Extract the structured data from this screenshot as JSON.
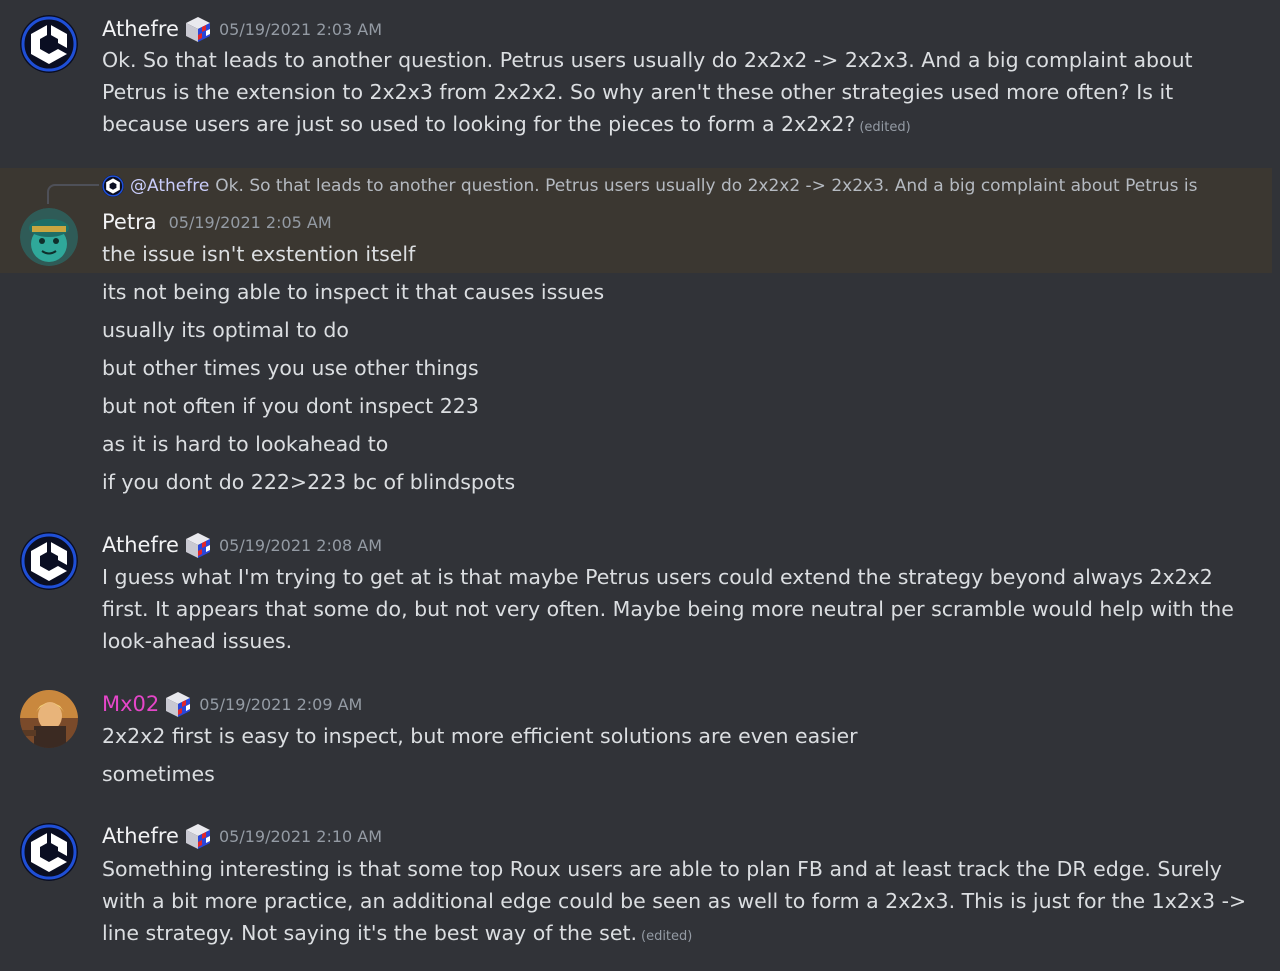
{
  "messages": [
    {
      "author": "Athefre",
      "timestamp": "05/19/2021 2:03 AM",
      "lines": [
        "Ok. So that leads to another question. Petrus users usually do 2x2x2 -> 2x2x3. And a big complaint about",
        "Petrus is the extension to 2x2x3 from 2x2x2. So why aren't these other strategies used more often? Is it",
        "because users are just so used to looking for the pieces to form a 2x2x2?"
      ],
      "edited": "(edited)"
    },
    {
      "reply": {
        "mention": "@Athefre",
        "text": "Ok. So that leads to another question. Petrus users usually do 2x2x2 -> 2x2x3. And a big complaint about Petrus is"
      },
      "author": "Petra",
      "timestamp": "05/19/2021 2:05 AM",
      "lines": [
        "the issue isn't exstention itself",
        "its not being able to inspect it that causes issues",
        "usually its optimal to do",
        "but other times you use other things",
        "but not often if you dont inspect 223",
        "as it is hard to lookahead to",
        "if you dont do 222>223 bc of blindspots"
      ]
    },
    {
      "author": "Athefre",
      "timestamp": "05/19/2021 2:08 AM",
      "lines": [
        "I guess what I'm trying to get at is that maybe Petrus users could extend the strategy beyond always 2x2x2",
        "first. It appears that some do, but not very often. Maybe being more neutral per scramble would help with the",
        "look-ahead issues."
      ]
    },
    {
      "author": "Mx02",
      "timestamp": "05/19/2021 2:09 AM",
      "lines": [
        "2x2x2 first is easy to inspect, but more efficient solutions are even easier",
        "sometimes"
      ]
    },
    {
      "author": "Athefre",
      "timestamp": "05/19/2021 2:10 AM",
      "lines": [
        "Something interesting is that some top Roux users are able to plan FB and at least track the DR edge. Surely",
        "with a bit more practice, an additional edge could be seen as well to form a 2x2x3. This is just for the 1x2x3 ->",
        "line strategy. Not saying it's the best way of the set."
      ],
      "edited": "(edited)"
    }
  ],
  "colors": {
    "background": "#313338",
    "reply_highlight": "#3b3731",
    "username_default": "#f2f3f5",
    "username_mx02": "#e546c9",
    "timestamp": "#949ba4",
    "text": "#dbdee1"
  },
  "icons": [
    "cube-logo-avatar-icon",
    "rubiks-cube-role-icon",
    "teal-character-avatar-icon",
    "anime-character-avatar-icon"
  ]
}
